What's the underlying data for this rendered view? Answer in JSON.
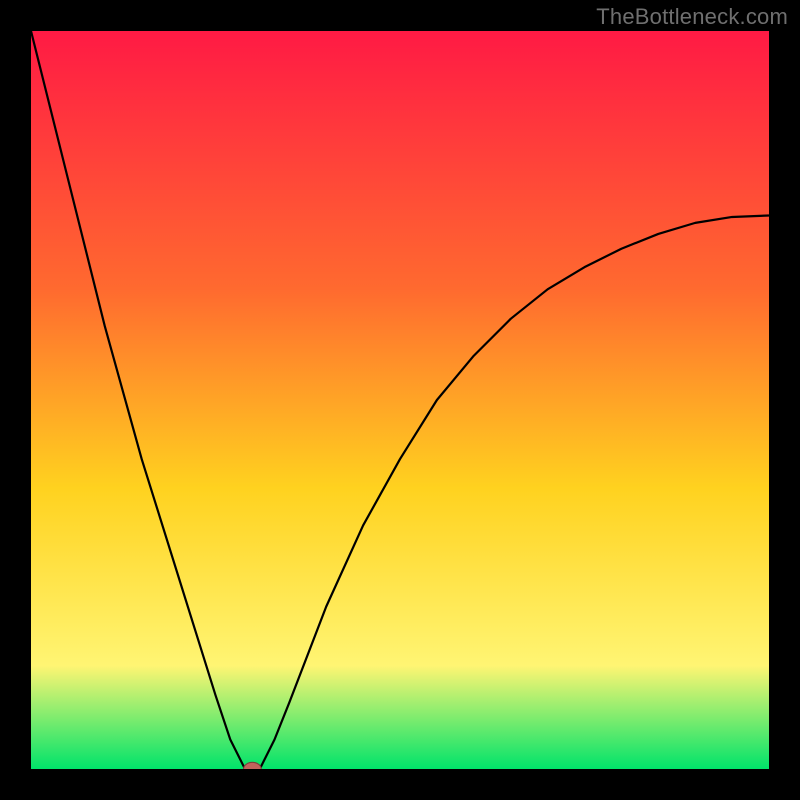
{
  "watermark": "TheBottleneck.com",
  "colors": {
    "frame": "#000000",
    "curve": "#000000",
    "marker_fill": "#c1635c",
    "marker_stroke": "#7a3f3b",
    "gradient_top": "#ff1a44",
    "gradient_mid1": "#ff6a2f",
    "gradient_mid2": "#ffd21f",
    "gradient_mid3": "#fff573",
    "gradient_bottom": "#00e36a"
  },
  "chart_data": {
    "type": "line",
    "title": "",
    "xlabel": "",
    "ylabel": "",
    "xlim": [
      0,
      100
    ],
    "ylim": [
      0,
      100
    ],
    "grid": false,
    "legend": false,
    "series": [
      {
        "name": "bottleneck-curve",
        "x": [
          0,
          5,
          10,
          15,
          20,
          25,
          27,
          29,
          30,
          31,
          33,
          35,
          40,
          45,
          50,
          55,
          60,
          65,
          70,
          75,
          80,
          85,
          90,
          95,
          100
        ],
        "y": [
          100,
          80,
          60,
          42,
          26,
          10,
          4,
          0,
          0,
          0,
          4,
          9,
          22,
          33,
          42,
          50,
          56,
          61,
          65,
          68,
          70.5,
          72.5,
          74,
          74.8,
          75
        ]
      }
    ],
    "marker": {
      "x": 30,
      "y": 0,
      "rx": 1.2,
      "ry": 0.9
    }
  }
}
